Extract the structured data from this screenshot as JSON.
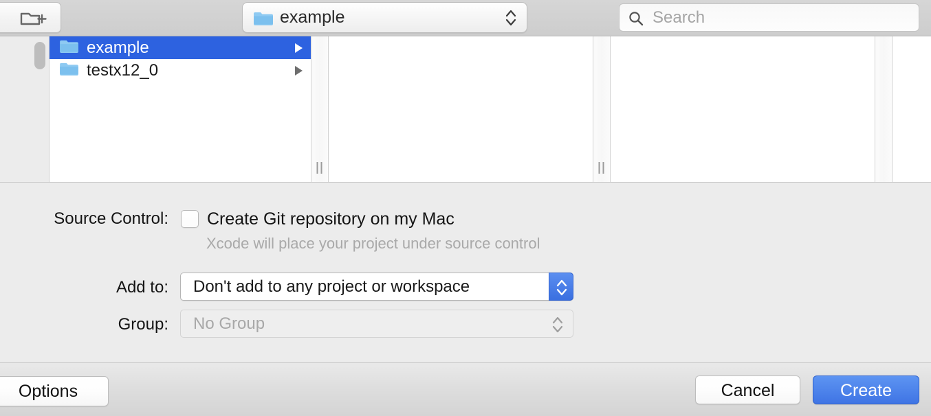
{
  "toolbar": {
    "new_folder_button_icon": "new-folder-icon",
    "path_popup": {
      "icon": "folder-icon",
      "value": "example",
      "stepper_icon": "chevron-up-down-icon"
    },
    "search": {
      "icon": "search-icon",
      "placeholder": "Search",
      "value": ""
    }
  },
  "browser": {
    "scrollbar": "vertical-scrollbar",
    "columns": [
      {
        "items": [
          {
            "label": "example",
            "icon": "folder-icon",
            "selected": true,
            "disclosure": "disclosure-triangle"
          },
          {
            "label": "testx12_0",
            "icon": "folder-icon",
            "selected": false,
            "disclosure": "disclosure-triangle"
          }
        ]
      },
      {
        "items": []
      },
      {
        "items": []
      },
      {
        "items": []
      }
    ],
    "resize_grip_icon": "column-resize-grip"
  },
  "accessory": {
    "source_control": {
      "label": "Source Control:",
      "checkbox_label": "Create Git repository on my Mac",
      "checked": false,
      "help_text": "Xcode will place your project under source control"
    },
    "add_to": {
      "label": "Add to:",
      "value": "Don't add to any project or workspace",
      "enabled": true,
      "stepper_icon": "chevron-up-down-icon"
    },
    "group": {
      "label": "Group:",
      "value": "No Group",
      "enabled": false,
      "stepper_icon": "chevron-up-down-icon"
    }
  },
  "footer": {
    "options_label": "Options",
    "cancel_label": "Cancel",
    "create_label": "Create"
  },
  "colors": {
    "selection_blue": "#2d62e0",
    "default_button_blue": "#3f74e4",
    "folder_blue": "#8ecaf2",
    "panel_gray": "#ececec",
    "toolbar_gray": "#d2d2d2"
  }
}
